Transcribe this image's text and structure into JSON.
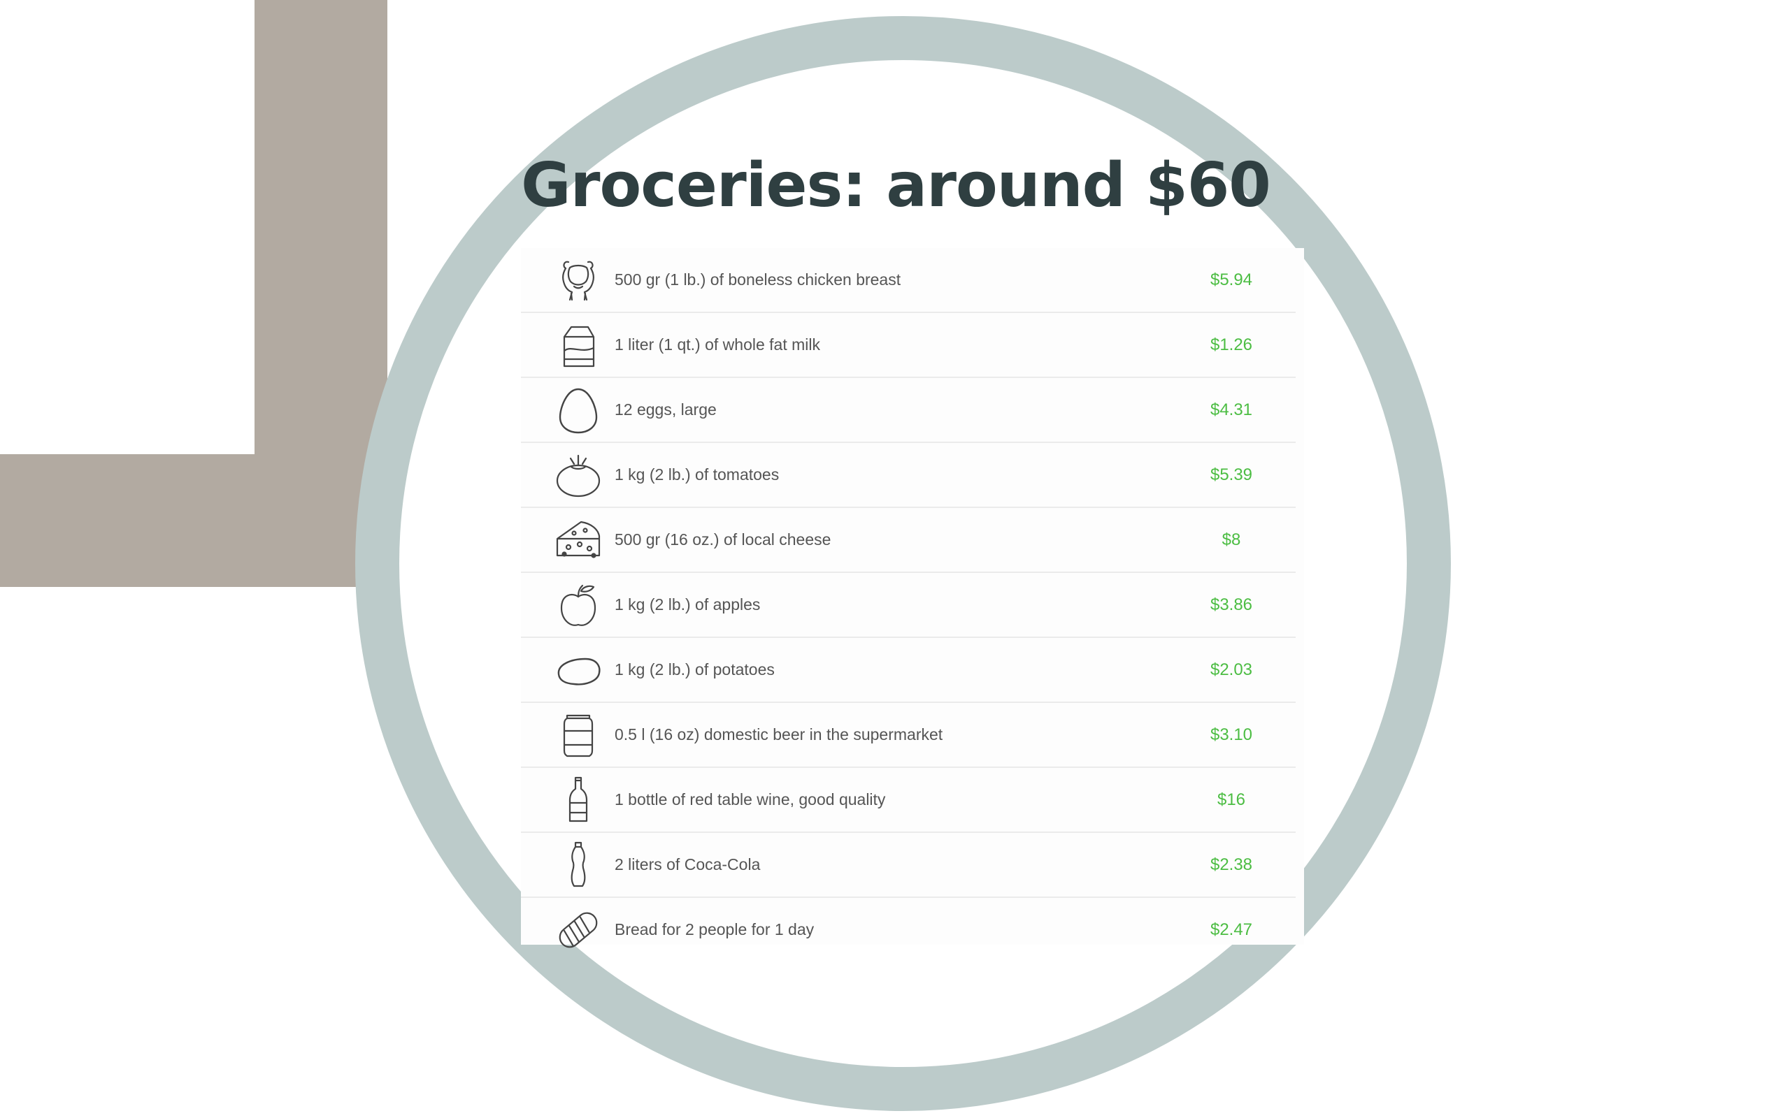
{
  "title": "Groceries: around $60",
  "colors": {
    "accent_price": "#4cbd43",
    "title": "#2f3f41",
    "ring": "#bccbca",
    "background_block": "#b2aaa1"
  },
  "items": [
    {
      "icon": "chicken-icon",
      "label": "500 gr (1 lb.) of boneless chicken breast",
      "price": "$5.94"
    },
    {
      "icon": "milk-carton-icon",
      "label": "1 liter (1 qt.) of whole fat milk",
      "price": "$1.26"
    },
    {
      "icon": "egg-icon",
      "label": "12 eggs, large",
      "price": "$4.31"
    },
    {
      "icon": "tomato-icon",
      "label": "1 kg (2 lb.) of tomatoes",
      "price": "$5.39"
    },
    {
      "icon": "cheese-icon",
      "label": "500 gr (16 oz.) of local cheese",
      "price": "$8"
    },
    {
      "icon": "apple-icon",
      "label": "1 kg (2 lb.) of apples",
      "price": "$3.86"
    },
    {
      "icon": "potato-icon",
      "label": "1 kg (2 lb.) of potatoes",
      "price": "$2.03"
    },
    {
      "icon": "beer-can-icon",
      "label": "0.5 l (16 oz) domestic beer in the supermarket",
      "price": "$3.10"
    },
    {
      "icon": "wine-bottle-icon",
      "label": "1 bottle of red table wine, good quality",
      "price": "$16"
    },
    {
      "icon": "soda-bottle-icon",
      "label": "2 liters of Coca-Cola",
      "price": "$2.38"
    },
    {
      "icon": "bread-icon",
      "label": "Bread for 2 people for 1 day",
      "price": "$2.47"
    }
  ]
}
